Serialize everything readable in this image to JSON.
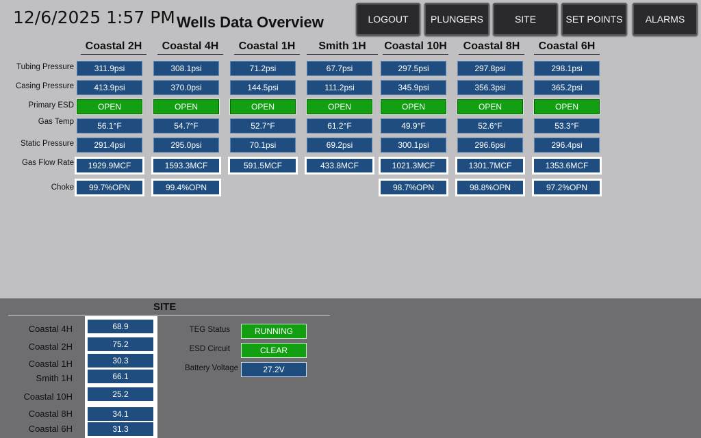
{
  "header": {
    "datetime": "12/6/2025 1:57 PM",
    "title": "Wells Data Overview"
  },
  "nav": [
    {
      "label": "LOGOUT"
    },
    {
      "label": "PLUNGERS"
    },
    {
      "label": "SITE"
    },
    {
      "label": "SET POINTS"
    },
    {
      "label": "ALARMS"
    }
  ],
  "rows": [
    {
      "label": "Tubing Pressure"
    },
    {
      "label": "Casing Pressure"
    },
    {
      "label": "Primary ESD"
    },
    {
      "label": "Gas Temp"
    },
    {
      "label": "Static Pressure"
    },
    {
      "label": "Gas Flow Rate"
    },
    {
      "label": "Choke"
    }
  ],
  "wells": [
    {
      "name": "Coastal 2H",
      "tubing": "311.9psi",
      "casing": "413.9psi",
      "esd": "OPEN",
      "gas_temp": "56.1°F",
      "static": "291.4psi",
      "flow": "1929.9MCF",
      "choke": "99.7%OPN"
    },
    {
      "name": "Coastal 4H",
      "tubing": "308.1psi",
      "casing": "370.0psi",
      "esd": "OPEN",
      "gas_temp": "54.7°F",
      "static": "295.0psi",
      "flow": "1593.3MCF",
      "choke": "99.4%OPN"
    },
    {
      "name": "Coastal 1H",
      "tubing": "71.2psi",
      "casing": "144.5psi",
      "esd": "OPEN",
      "gas_temp": "52.7°F",
      "static": "70.1psi",
      "flow": "591.5MCF",
      "choke": ""
    },
    {
      "name": "Smith 1H",
      "tubing": "67.7psi",
      "casing": "111.2psi",
      "esd": "OPEN",
      "gas_temp": "61.2°F",
      "static": "69.2psi",
      "flow": "433.8MCF",
      "choke": ""
    },
    {
      "name": "Coastal 10H",
      "tubing": "297.5psi",
      "casing": "345.9psi",
      "esd": "OPEN",
      "gas_temp": "49.9°F",
      "static": "300.1psi",
      "flow": "1021.3MCF",
      "choke": "98.7%OPN"
    },
    {
      "name": "Coastal 8H",
      "tubing": "297.8psi",
      "casing": "356.3psi",
      "esd": "OPEN",
      "gas_temp": "52.6°F",
      "static": "296.6psi",
      "flow": "1301.7MCF",
      "choke": "98.8%OPN"
    },
    {
      "name": "Coastal 6H",
      "tubing": "298.1psi",
      "casing": "365.2psi",
      "esd": "OPEN",
      "gas_temp": "53.3°F",
      "static": "296.4psi",
      "flow": "1353.6MCF",
      "choke": "97.2%OPN"
    }
  ],
  "site": {
    "title": "SITE",
    "wells": [
      {
        "name": "Coastal 4H",
        "value": "68.9"
      },
      {
        "name": "Coastal 2H",
        "value": "75.2"
      },
      {
        "name": "Coastal 1H",
        "value": "30.3"
      },
      {
        "name": "Smith 1H",
        "value": "66.1"
      },
      {
        "name": "Coastal 10H",
        "value": "25.2"
      },
      {
        "name": "Coastal 8H",
        "value": "34.1"
      },
      {
        "name": "Coastal 6H",
        "value": "31.3"
      }
    ],
    "teg_status": {
      "label": "TEG Status",
      "value": "RUNNING"
    },
    "esd_circuit": {
      "label": "ESD Circuit",
      "value": "CLEAR"
    },
    "battery_voltage": {
      "label": "Battery Voltage",
      "value": "27.2V"
    }
  },
  "colors": {
    "panel_bg": "#c0bfc2",
    "site_bg": "#6e6d70",
    "value_blue": "#1f4d80",
    "status_green": "#12a012",
    "button_dark": "#2a2a2c"
  }
}
